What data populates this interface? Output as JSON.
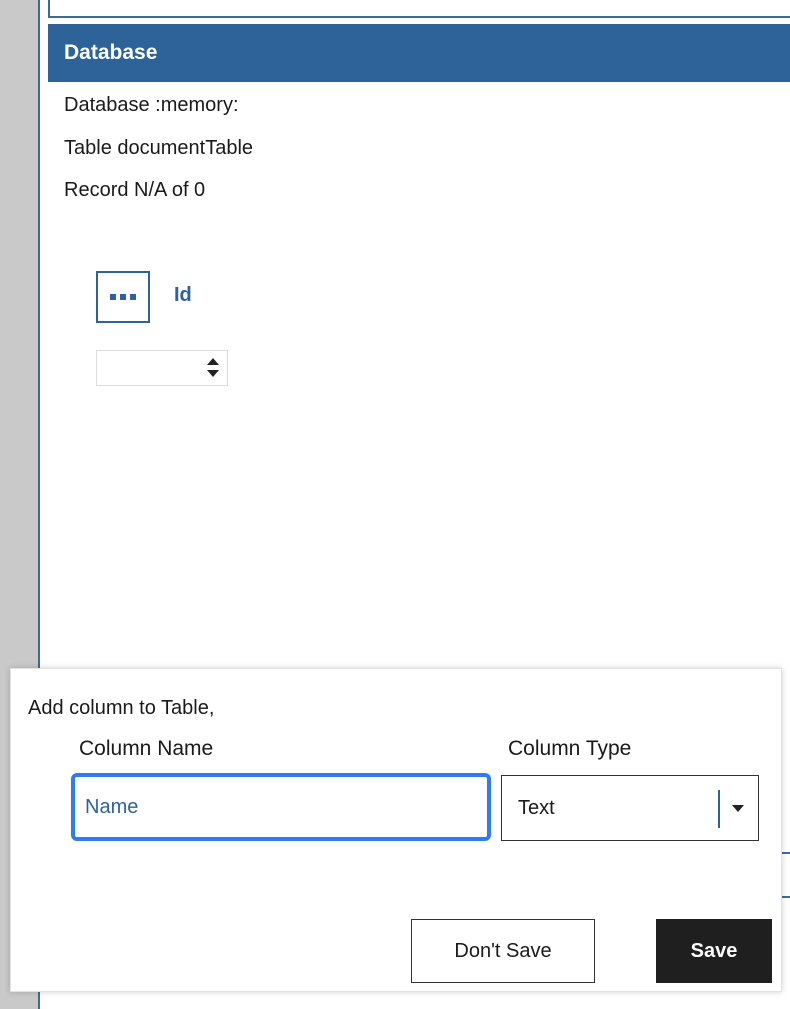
{
  "database_panel": {
    "header": "Database",
    "database_line": "Database :memory:",
    "table_line": "Table documentTable",
    "record_line": "Record N/A of 0",
    "field": {
      "icon": "ellipsis-icon",
      "label": "Id",
      "value": ""
    }
  },
  "add_column_dialog": {
    "title": "Add column to Table,",
    "column_name_label": "Column Name",
    "column_name_value": "Name",
    "column_type_label": "Column Type",
    "column_type_selected": "Text",
    "dont_save_label": "Don't Save",
    "save_label": "Save"
  },
  "colors": {
    "header_bg": "#2e6399",
    "focus_ring": "#2f7bf1",
    "save_bg": "#1f1f1f"
  }
}
